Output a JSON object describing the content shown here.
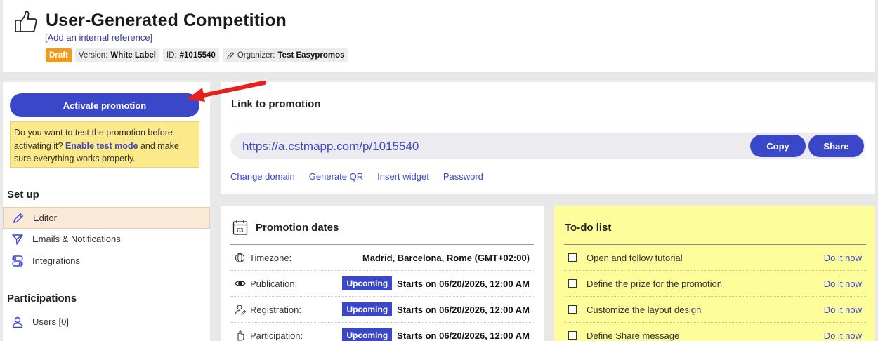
{
  "header": {
    "title": "User-Generated Competition",
    "ref_open": "[",
    "ref_link": "Add an internal reference",
    "ref_close": "]",
    "badges": {
      "draft": "Draft",
      "version_label": "Version:",
      "version_value": "White Label",
      "id_label": "ID:",
      "id_value": "#1015540",
      "organizer_label": "Organizer:",
      "organizer_value": "Test Easypromos"
    }
  },
  "sidebar": {
    "activate_button": "Activate promotion",
    "test_notice": {
      "pre": "Do you want to test the promotion before activating it?",
      "link": "Enable test mode",
      "post": "and make sure everything works properly."
    },
    "setup_title": "Set up",
    "setup_items": [
      {
        "label": "Editor",
        "icon": "pencil-icon",
        "active": true
      },
      {
        "label": "Emails & Notifications",
        "icon": "send-icon",
        "active": false
      },
      {
        "label": "Integrations",
        "icon": "toggles-icon",
        "active": false
      }
    ],
    "participations_title": "Participations",
    "participation_items": [
      {
        "label": "Users [0]",
        "icon": "user-icon"
      }
    ]
  },
  "link_card": {
    "title": "Link to promotion",
    "url": "https://a.cstmapp.com/p/1015540",
    "copy_button": "Copy",
    "share_button": "Share",
    "links": [
      "Change domain",
      "Generate QR",
      "Insert widget",
      "Password"
    ]
  },
  "dates_card": {
    "title": "Promotion dates",
    "calendar_day": "03",
    "rows": [
      {
        "label": "Timezone:",
        "icon": "globe-icon",
        "badge": "",
        "value": "Madrid, Barcelona, Rome (GMT+02:00)"
      },
      {
        "label": "Publication:",
        "icon": "eye-icon",
        "badge": "Upcoming",
        "value": "Starts on 06/20/2026, 12:00 AM"
      },
      {
        "label": "Registration:",
        "icon": "user-edit-icon",
        "badge": "Upcoming",
        "value": "Starts on 06/20/2026, 12:00 AM"
      },
      {
        "label": "Participation:",
        "icon": "hand-icon",
        "badge": "Upcoming",
        "value": "Starts on 06/20/2026, 12:00 AM"
      }
    ]
  },
  "todo_card": {
    "title": "To-do list",
    "action_label": "Do it now",
    "items": [
      "Open and follow tutorial",
      "Define the prize for the promotion",
      "Customize the layout design",
      "Define Share message"
    ]
  },
  "colors": {
    "accent": "#3b47c9",
    "draft_badge": "#f29a1f",
    "notice_bg": "#fbe98a",
    "todo_bg": "#fdfd9c",
    "annotation_arrow": "#e8201a"
  }
}
